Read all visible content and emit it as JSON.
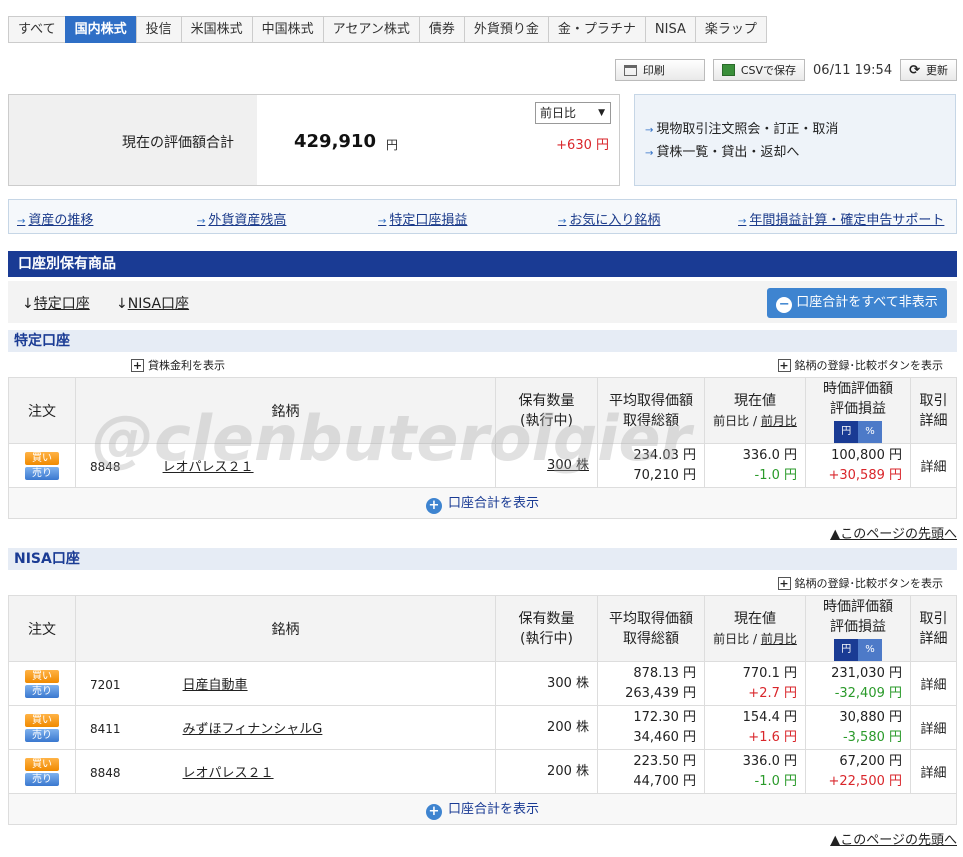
{
  "tabs": [
    "すべて",
    "国内株式",
    "投信",
    "米国株式",
    "中国株式",
    "アセアン株式",
    "債券",
    "外貨預り金",
    "金・プラチナ",
    "NISA",
    "楽ラップ"
  ],
  "toolbar": {
    "print": "印刷",
    "csv": "CSVで保存",
    "datetime": "06/11 19:54",
    "refresh": "更新"
  },
  "valuation": {
    "label": "現在の評価額合計",
    "amount": "429,910",
    "unit": "円",
    "compare": "前日比",
    "change": "+630 円"
  },
  "side_links": [
    "現物取引注文照会・訂正・取消",
    "貸株一覧・貸出・返却へ"
  ],
  "nav_links": [
    "資産の推移",
    "外貨資産残高",
    "特定口座損益",
    "お気に入り銘柄",
    "年間損益計算・確定申告サポート"
  ],
  "section_title": "口座別保有商品",
  "jump_links": [
    "特定口座",
    "NISA口座"
  ],
  "hide_totals": "口座合計をすべて非表示",
  "lending_rate": "貸株金利を表示",
  "register_compare": "銘柄の登録･比較ボタンを表示",
  "headers": {
    "order": "注文",
    "name": "銘柄",
    "qty1": "保有数量",
    "qty2": "(執行中)",
    "avg1": "平均取得価額",
    "avg2": "取得総額",
    "price1": "現在値",
    "price2a": "前日比",
    "price2sep": " / ",
    "price2b": "前月比",
    "val1": "時価評価額",
    "val2": "評価損益",
    "yen": "円",
    "pct": "%",
    "detail1": "取引",
    "detail2": "詳細"
  },
  "buy": "買い",
  "sell": "売り",
  "detail": "詳細",
  "show_total": "口座合計を表示",
  "to_top": "▲このページの先頭へ",
  "tokutei": {
    "title": "特定口座",
    "rows": [
      {
        "code": "8848",
        "name": "レオパレス２１",
        "qty": "300 株",
        "avg": "234.03 円",
        "total": "70,210 円",
        "price": "336.0 円",
        "diff": "-1.0 円",
        "value": "100,800 円",
        "pl": "+30,589 円",
        "diff_color": "#2a9a2a",
        "pl_color": "#d9262b"
      }
    ]
  },
  "nisa": {
    "title": "NISA口座",
    "rows": [
      {
        "code": "7201",
        "name": "日産自動車",
        "qty": "300 株",
        "avg": "878.13 円",
        "total": "263,439 円",
        "price": "770.1 円",
        "diff": "+2.7 円",
        "value": "231,030 円",
        "pl": "-32,409 円",
        "diff_color": "#d9262b",
        "pl_color": "#2a9a2a"
      },
      {
        "code": "8411",
        "name": "みずほフィナンシャルG",
        "qty": "200 株",
        "avg": "172.30 円",
        "total": "34,460 円",
        "price": "154.4 円",
        "diff": "+1.6 円",
        "value": "30,880 円",
        "pl": "-3,580 円",
        "diff_color": "#d9262b",
        "pl_color": "#2a9a2a"
      },
      {
        "code": "8848",
        "name": "レオパレス２１",
        "qty": "200 株",
        "avg": "223.50 円",
        "total": "44,700 円",
        "price": "336.0 円",
        "diff": "-1.0 円",
        "value": "67,200 円",
        "pl": "+22,500 円",
        "diff_color": "#2a9a2a",
        "pl_color": "#d9262b"
      }
    ]
  },
  "watermark": "@clenbuterolgier"
}
